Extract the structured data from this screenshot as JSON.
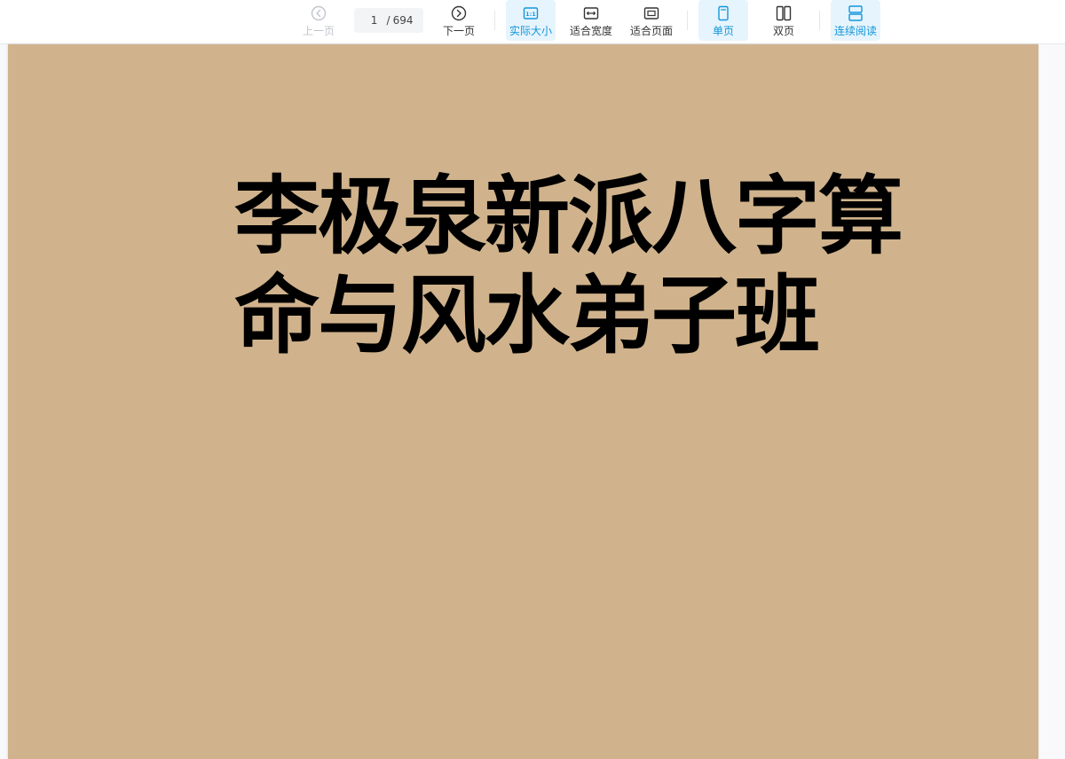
{
  "toolbar": {
    "prev_label": "上一页",
    "next_label": "下一页",
    "page_current": "1",
    "page_separator": "/",
    "page_total": "694",
    "actual_size_label": "实际大小",
    "fit_width_label": "适合宽度",
    "fit_page_label": "适合页面",
    "single_page_label": "单页",
    "double_page_label": "双页",
    "continuous_label": "连续阅读"
  },
  "document": {
    "title_line1": "李极泉新派八字算",
    "title_line2": "命与风水弟子班"
  },
  "colors": {
    "accent": "#1296db",
    "accent_bg": "#e6f4fd",
    "page_bg": "#d0b38c",
    "disabled": "#c0c4cc"
  }
}
